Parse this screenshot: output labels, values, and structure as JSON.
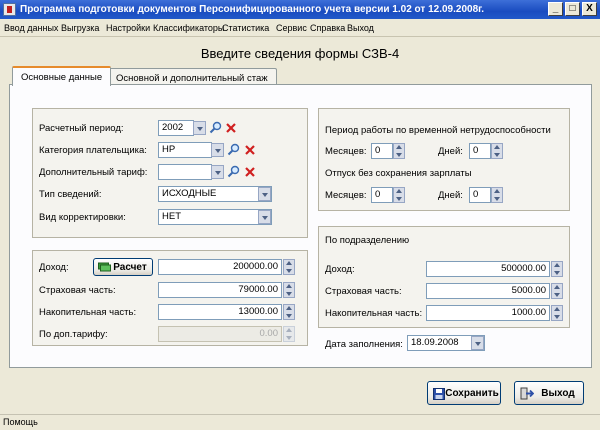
{
  "window": {
    "title": "Программа подготовки документов Персонифицированного учета версии 1.02 от 12.09.2008г.",
    "buttons": {
      "minimize": "_",
      "maximize": "□",
      "close": "X"
    }
  },
  "menu": [
    "Ввод данных",
    "Выгрузка",
    "Настройки",
    "Классификаторы",
    "Статистика",
    "Сервис",
    "Справка",
    "Выход"
  ],
  "form": {
    "heading": "Введите сведения формы СЗВ-4"
  },
  "tabs": [
    {
      "label": "Основные данные",
      "active": true
    },
    {
      "label": "Основной и дополнительный стаж",
      "active": false
    }
  ],
  "basic": {
    "period_label": "Расчетный период:",
    "period_value": "2002",
    "category_label": "Категория плательщика:",
    "category_value": "НР",
    "tariff_label": "Дополнительный тариф:",
    "tariff_value": "",
    "info_type_label": "Тип сведений:",
    "info_type_value": "ИСХОДНЫЕ",
    "correction_label": "Вид корректировки:",
    "correction_value": "НЕТ"
  },
  "income": {
    "income_label": "Доход:",
    "calc_button": "Расчет",
    "income_value": "200000.00",
    "insurance_label": "Страховая часть:",
    "insurance_value": "79000.00",
    "funded_label": "Накопительная часть:",
    "funded_value": "13000.00",
    "extra_label": "По доп.тарифу:",
    "extra_value": "0.00"
  },
  "disability": {
    "title": "Период работы по временной нетрудоспособности",
    "months_label": "Месяцев:",
    "months_value": "0",
    "days_label": "Дней:",
    "days_value": "0",
    "unpaid_title": "Отпуск без сохранения зарплаты",
    "unpaid_months_label": "Месяцев:",
    "unpaid_months_value": "0",
    "unpaid_days_label": "Дней:",
    "unpaid_days_value": "0"
  },
  "division": {
    "title": "По подразделению",
    "income_label": "Доход:",
    "income_value": "500000.00",
    "insurance_label": "Страховая часть:",
    "insurance_value": "5000.00",
    "funded_label": "Накопительная часть:",
    "funded_value": "1000.00"
  },
  "fill_date": {
    "label": "Дата заполнения:",
    "value": "18.09.2008"
  },
  "actions": {
    "save": "Сохранить",
    "exit": "Выход"
  },
  "status": {
    "text": "Помощь"
  },
  "colors": {
    "titlebar": "#1a4cc0",
    "face": "#ece9d8",
    "delete_x": "#d02020",
    "tab_highlight": "#e68b2c"
  }
}
